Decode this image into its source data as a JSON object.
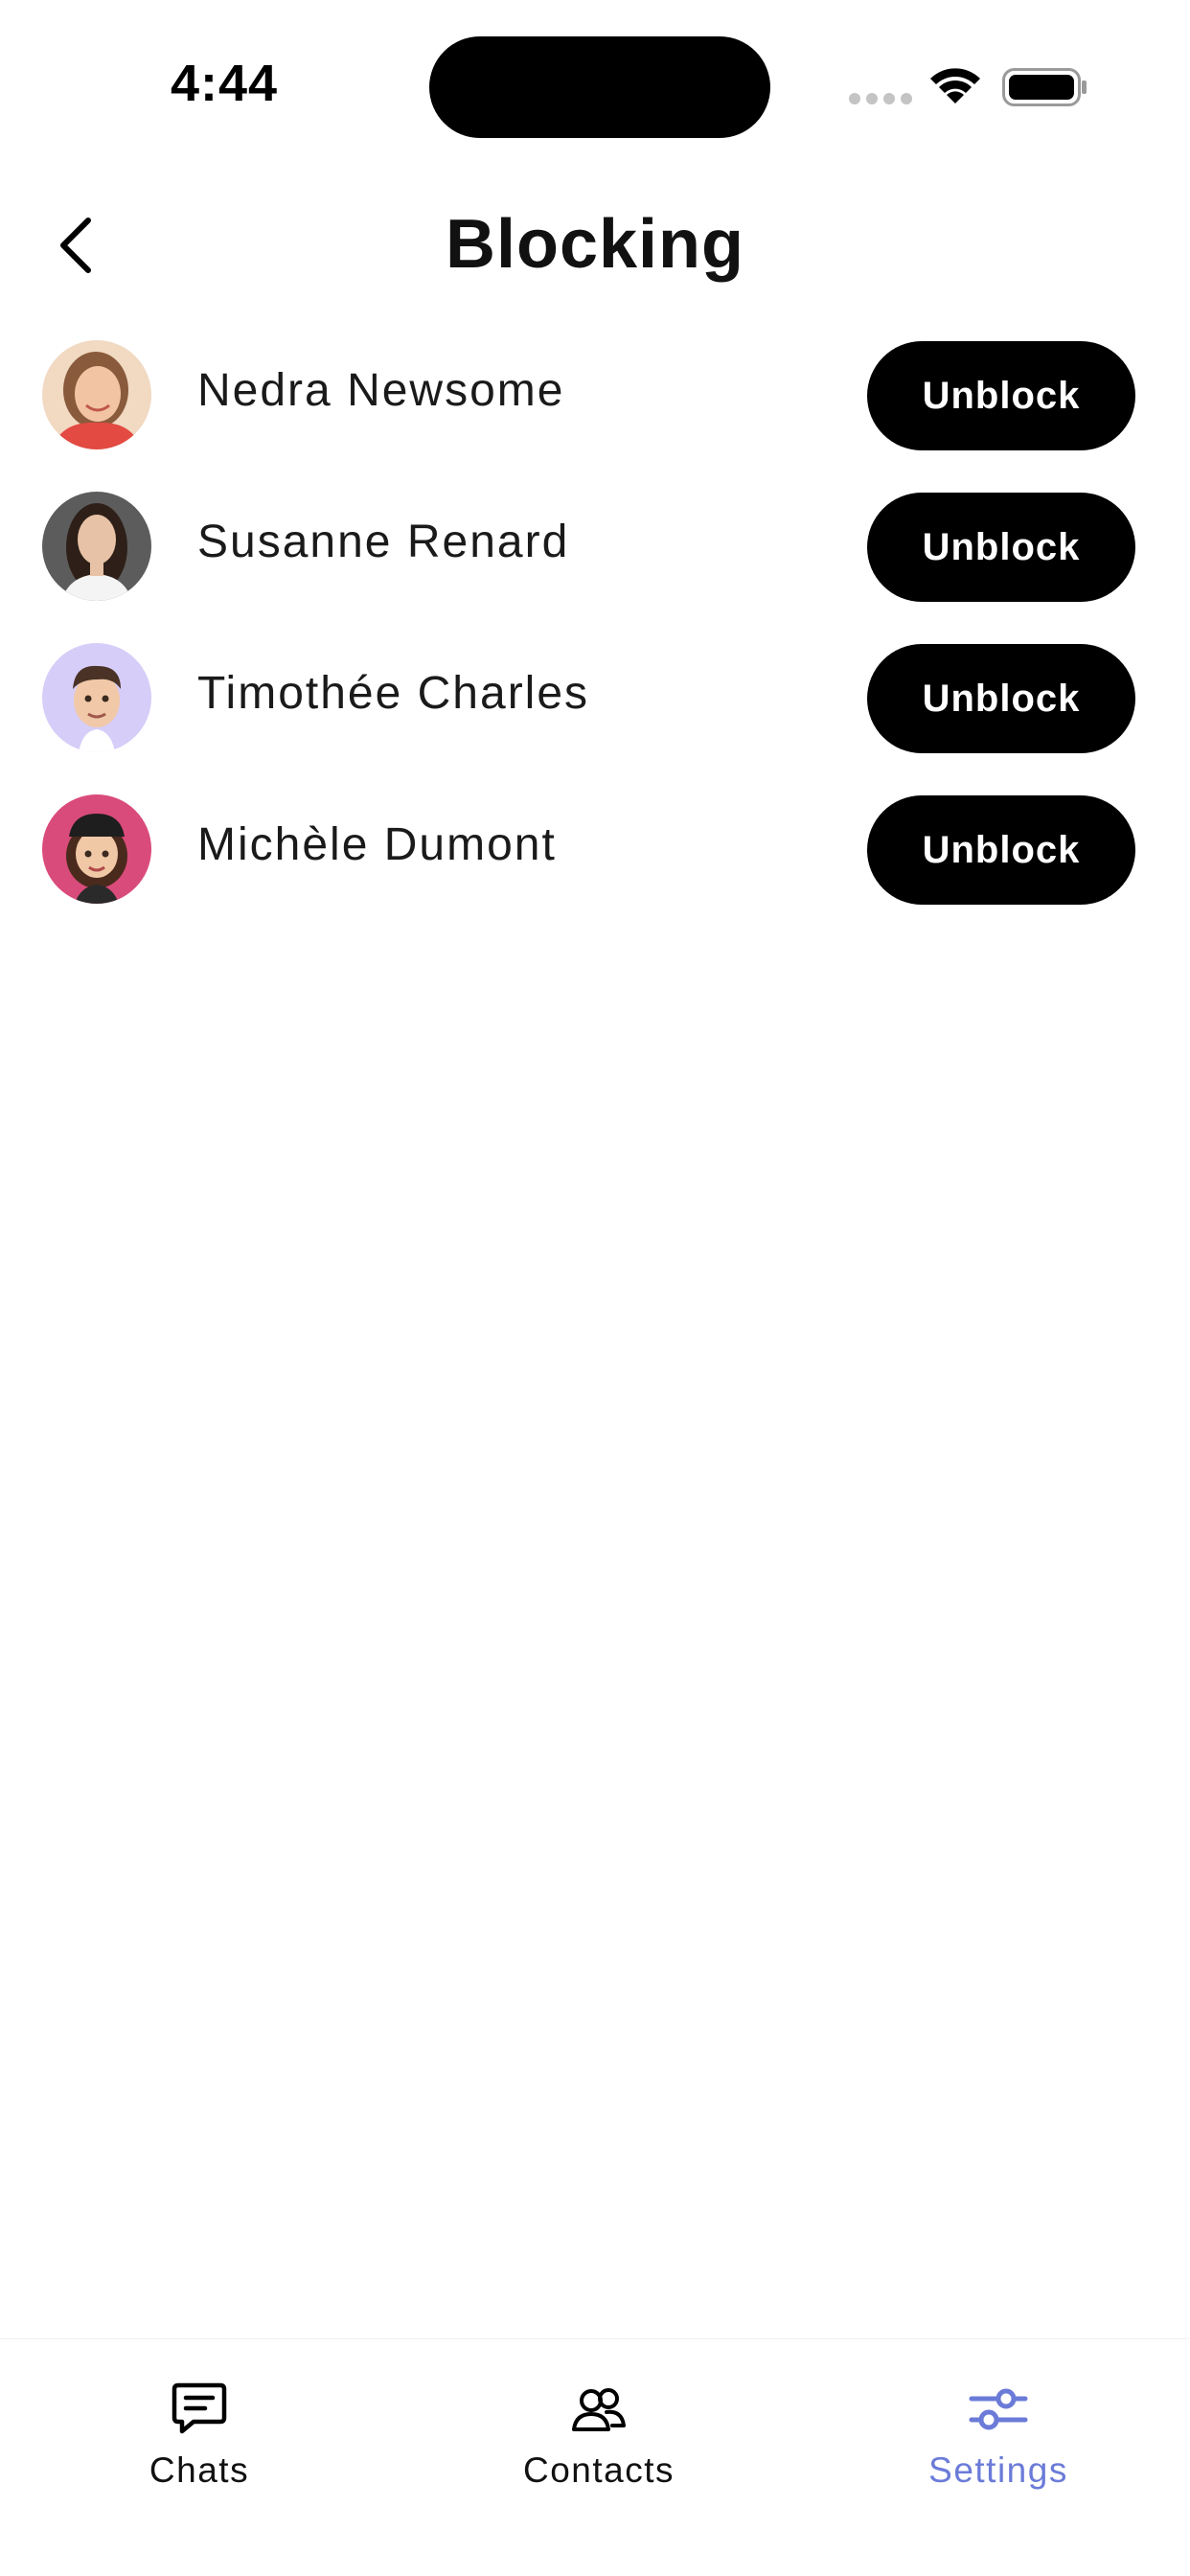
{
  "status_bar": {
    "time": "4:44",
    "icons": [
      "signal-dots-icon",
      "wifi-icon",
      "battery-icon"
    ]
  },
  "header": {
    "title": "Blocking",
    "back_icon": "chevron-left-icon"
  },
  "blocked_users": [
    {
      "name": "Nedra Newsome",
      "action": "Unblock",
      "avatar": "photo-woman-smiling"
    },
    {
      "name": "Susanne Renard",
      "action": "Unblock",
      "avatar": "photo-woman-dark-hair"
    },
    {
      "name": "Timothée Charles",
      "action": "Unblock",
      "avatar": "memoji-man"
    },
    {
      "name": "Michèle Dumont",
      "action": "Unblock",
      "avatar": "memoji-woman-cap"
    }
  ],
  "tab_bar": {
    "items": [
      {
        "label": "Chats",
        "icon": "chat-bubble-icon",
        "active": false
      },
      {
        "label": "Contacts",
        "icon": "contacts-icon",
        "active": false
      },
      {
        "label": "Settings",
        "icon": "sliders-icon",
        "active": true
      }
    ]
  },
  "colors": {
    "accent": "#6b7bd8",
    "button_bg": "#000000",
    "button_text": "#ffffff",
    "background": "#ffffff"
  }
}
